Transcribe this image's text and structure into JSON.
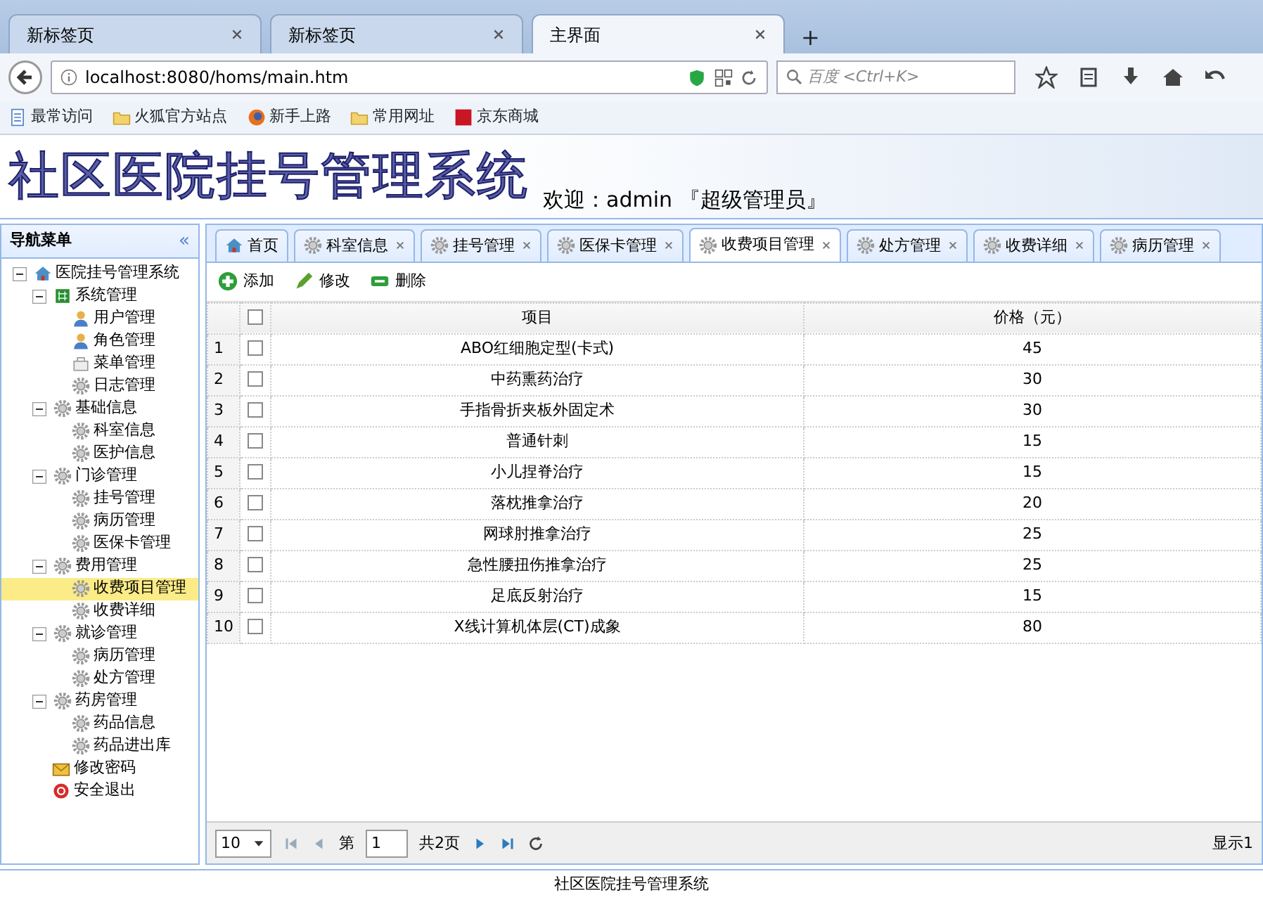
{
  "browser": {
    "tabs": [
      {
        "label": "新标签页",
        "selected": false
      },
      {
        "label": "新标签页",
        "selected": false
      },
      {
        "label": "主界面",
        "selected": true
      }
    ],
    "new_tab": "+",
    "address": "localhost:8080/homs/main.htm",
    "search_placeholder": "百度 <Ctrl+K>",
    "bookmarks": [
      {
        "label": "最常访问",
        "kind": "page"
      },
      {
        "label": "火狐官方站点",
        "kind": "folder"
      },
      {
        "label": "新手上路",
        "kind": "globe"
      },
      {
        "label": "常用网址",
        "kind": "folder"
      },
      {
        "label": "京东商城",
        "kind": "jd"
      }
    ]
  },
  "header": {
    "logo": "社区医院挂号管理系统",
    "welcome": "欢迎：admin 『超级管理员』"
  },
  "sidebar": {
    "title": "导航菜单",
    "collapse": "«",
    "tree": [
      {
        "label": "医院挂号管理系统",
        "kind": "home",
        "expanded": true,
        "selected": false,
        "children": [
          {
            "label": "系统管理",
            "kind": "grid",
            "expanded": true,
            "selected": false,
            "children": [
              {
                "label": "用户管理",
                "kind": "user",
                "selected": false
              },
              {
                "label": "角色管理",
                "kind": "user",
                "selected": false
              },
              {
                "label": "菜单管理",
                "kind": "menu",
                "selected": false
              },
              {
                "label": "日志管理",
                "kind": "gear",
                "selected": false
              }
            ]
          },
          {
            "label": "基础信息",
            "kind": "gear",
            "expanded": true,
            "selected": false,
            "children": [
              {
                "label": "科室信息",
                "kind": "gear",
                "selected": false
              },
              {
                "label": "医护信息",
                "kind": "gear",
                "selected": false
              }
            ]
          },
          {
            "label": "门诊管理",
            "kind": "gear",
            "expanded": true,
            "selected": false,
            "children": [
              {
                "label": "挂号管理",
                "kind": "gear",
                "selected": false
              },
              {
                "label": "病历管理",
                "kind": "gear",
                "selected": false
              },
              {
                "label": "医保卡管理",
                "kind": "gear",
                "selected": false
              }
            ]
          },
          {
            "label": "费用管理",
            "kind": "gear",
            "expanded": true,
            "selected": false,
            "children": [
              {
                "label": "收费项目管理",
                "kind": "gear",
                "selected": true
              },
              {
                "label": "收费详细",
                "kind": "gear",
                "selected": false
              }
            ]
          },
          {
            "label": "就诊管理",
            "kind": "gear",
            "expanded": true,
            "selected": false,
            "children": [
              {
                "label": "病历管理",
                "kind": "gear",
                "selected": false
              },
              {
                "label": "处方管理",
                "kind": "gear",
                "selected": false
              }
            ]
          },
          {
            "label": "药房管理",
            "kind": "gear",
            "expanded": true,
            "selected": false,
            "children": [
              {
                "label": "药品信息",
                "kind": "gear",
                "selected": false
              },
              {
                "label": "药品进出库",
                "kind": "gear",
                "selected": false
              }
            ]
          },
          {
            "label": "修改密码",
            "kind": "key",
            "selected": false
          },
          {
            "label": "安全退出",
            "kind": "exit",
            "selected": false
          }
        ]
      }
    ]
  },
  "tabs": [
    {
      "label": "首页",
      "kind": "home",
      "closable": false,
      "selected": false
    },
    {
      "label": "科室信息",
      "kind": "gear",
      "closable": true,
      "selected": false
    },
    {
      "label": "挂号管理",
      "kind": "gear",
      "closable": true,
      "selected": false
    },
    {
      "label": "医保卡管理",
      "kind": "gear",
      "closable": true,
      "selected": false
    },
    {
      "label": "收费项目管理",
      "kind": "gear",
      "closable": true,
      "selected": true
    },
    {
      "label": "处方管理",
      "kind": "gear",
      "closable": true,
      "selected": false
    },
    {
      "label": "收费详细",
      "kind": "gear",
      "closable": true,
      "selected": false
    },
    {
      "label": "病历管理",
      "kind": "gear",
      "closable": true,
      "selected": false
    }
  ],
  "toolbar": [
    {
      "label": "添加",
      "kind": "add"
    },
    {
      "label": "修改",
      "kind": "edit"
    },
    {
      "label": "删除",
      "kind": "delete"
    }
  ],
  "table": {
    "columns": [
      "项目",
      "价格（元）"
    ],
    "header_checked": false,
    "rows": [
      {
        "index": "1",
        "checked": false,
        "item": "ABO红细胞定型(卡式)",
        "price": "45"
      },
      {
        "index": "2",
        "checked": false,
        "item": "中药熏药治疗",
        "price": "30"
      },
      {
        "index": "3",
        "checked": false,
        "item": "手指骨折夹板外固定术",
        "price": "30"
      },
      {
        "index": "4",
        "checked": false,
        "item": "普通针刺",
        "price": "15"
      },
      {
        "index": "5",
        "checked": false,
        "item": "小儿捏脊治疗",
        "price": "15"
      },
      {
        "index": "6",
        "checked": false,
        "item": "落枕推拿治疗",
        "price": "20"
      },
      {
        "index": "7",
        "checked": false,
        "item": "网球肘推拿治疗",
        "price": "25"
      },
      {
        "index": "8",
        "checked": false,
        "item": "急性腰扭伤推拿治疗",
        "price": "25"
      },
      {
        "index": "9",
        "checked": false,
        "item": "足底反射治疗",
        "price": "15"
      },
      {
        "index": "10",
        "checked": false,
        "item": "X线计算机体层(CT)成象",
        "price": "80"
      }
    ]
  },
  "pager": {
    "page_size": "10",
    "page_prefix": "第",
    "page": "1",
    "total": "共2页",
    "summary": "显示1"
  },
  "footer": "社区医院挂号管理系统"
}
